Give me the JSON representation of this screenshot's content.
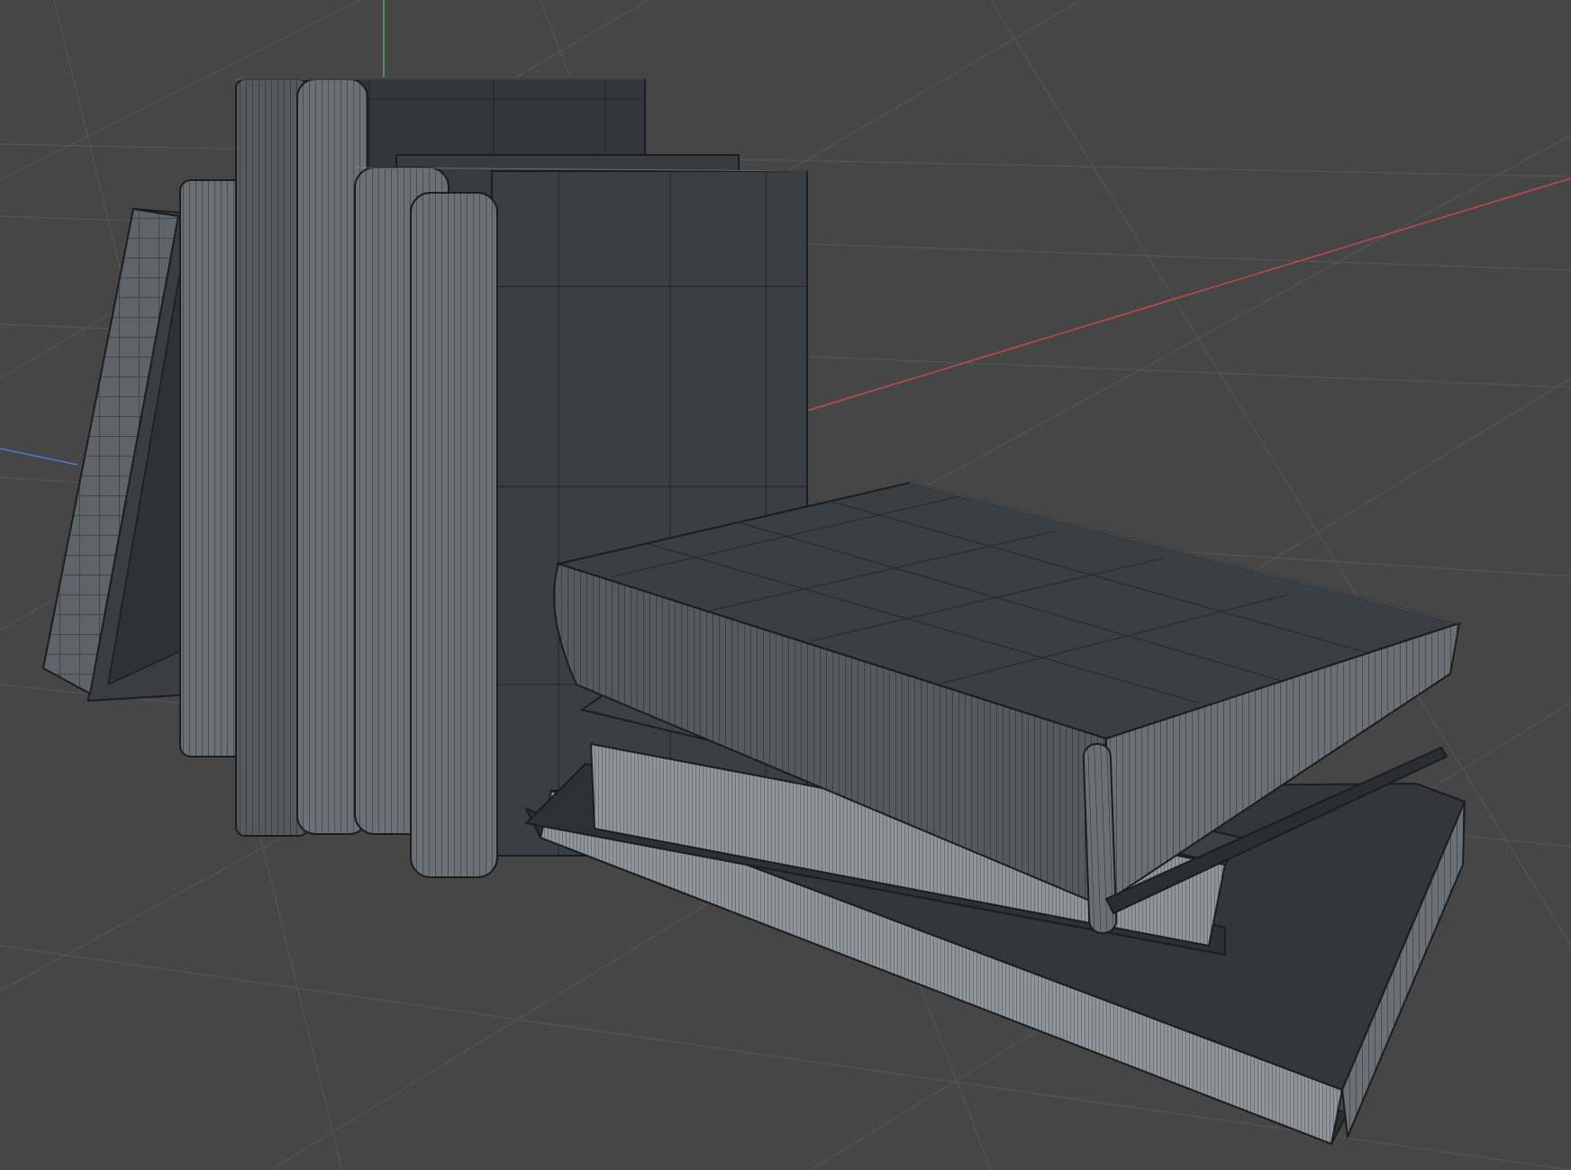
{
  "viewport": {
    "background": "#464646",
    "grid_color": "#555555",
    "axis_colors": {
      "x": "#c24a4a",
      "y": "#4fae6c",
      "z": "#4a7bd0"
    }
  },
  "scene": {
    "objects": [
      "leaning-book",
      "book-spine-1",
      "book-spine-2",
      "book-spine-3",
      "book-spine-4",
      "upright-book-back",
      "upright-book-front",
      "book-bottom-flat",
      "book-middle-flat",
      "book-top-flat"
    ],
    "mesh_fill": "#2f3337",
    "wire_color": "#1b1d1f",
    "edge_color": "#8a9096"
  }
}
